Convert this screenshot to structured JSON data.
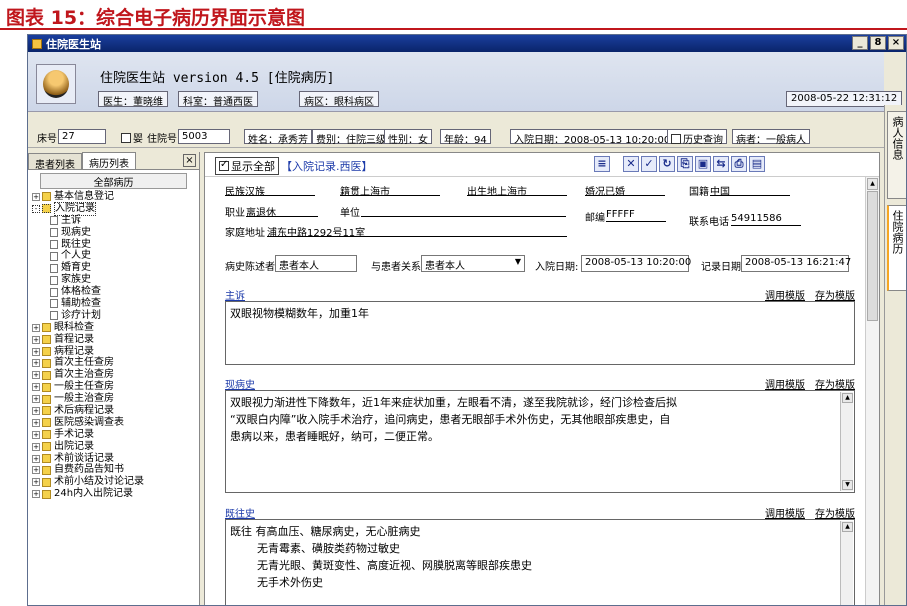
{
  "figure_title": "图表 15：综合电子病历界面示意图",
  "window": {
    "title": "住院医生站",
    "buttons": [
      "_",
      "8",
      "×"
    ]
  },
  "header": {
    "app_title": "住院医生站 version 4.5 [住院病历]",
    "doctor": "医生：董晓维",
    "department": "科室：普通西医",
    "ward": "病区：眼科病区",
    "datetime": "2008-05-22 12:31:12"
  },
  "infobar": {
    "bed_label": "床号",
    "bed_value": "27",
    "baby_label": "婴",
    "inpatient_label": "住院号",
    "inpatient_value": "5003",
    "name": "姓名：承秀芳",
    "fee_type": "费别：住院三级",
    "sex": "性别：女",
    "age": "年龄：94",
    "admit_date": "入院日期：2008-05-13 10:20:00",
    "history_button": "历史查询",
    "patient_type": "病者：一般病人"
  },
  "right_tabs": [
    "病人信息",
    "住院病历"
  ],
  "left_panel": {
    "tabs": [
      "患者列表",
      "病历列表"
    ],
    "close": "×",
    "tree_header": "全部病历",
    "tree": [
      {
        "label": "基本信息登记",
        "type": "folder",
        "level": 0,
        "pm": "+"
      },
      {
        "label": "入院记录",
        "type": "folder",
        "level": 0,
        "pm": "-",
        "selected": true
      },
      {
        "label": "主诉",
        "type": "doc",
        "level": 1
      },
      {
        "label": "现病史",
        "type": "doc",
        "level": 1
      },
      {
        "label": "既往史",
        "type": "doc",
        "level": 1
      },
      {
        "label": "个人史",
        "type": "doc",
        "level": 1
      },
      {
        "label": "婚育史",
        "type": "doc",
        "level": 1
      },
      {
        "label": "家族史",
        "type": "doc",
        "level": 1
      },
      {
        "label": "体格检查",
        "type": "doc",
        "level": 1
      },
      {
        "label": "辅助检查",
        "type": "doc",
        "level": 1
      },
      {
        "label": "诊疗计划",
        "type": "doc",
        "level": 1
      },
      {
        "label": "眼科检查",
        "type": "folder",
        "level": 0,
        "pm": "+"
      },
      {
        "label": "首程记录",
        "type": "folder",
        "level": 0,
        "pm": "+"
      },
      {
        "label": "病程记录",
        "type": "folder",
        "level": 0,
        "pm": "+"
      },
      {
        "label": "首次主任查房",
        "type": "folder",
        "level": 0,
        "pm": "+"
      },
      {
        "label": "首次主治查房",
        "type": "folder",
        "level": 0,
        "pm": "+"
      },
      {
        "label": "一般主任查房",
        "type": "folder",
        "level": 0,
        "pm": "+"
      },
      {
        "label": "一般主治查房",
        "type": "folder",
        "level": 0,
        "pm": "+"
      },
      {
        "label": "术后病程记录",
        "type": "folder",
        "level": 0,
        "pm": "+"
      },
      {
        "label": "医院感染调查表",
        "type": "folder",
        "level": 0,
        "pm": "+"
      },
      {
        "label": "手术记录",
        "type": "folder",
        "level": 0,
        "pm": "+"
      },
      {
        "label": "出院记录",
        "type": "folder",
        "level": 0,
        "pm": "+"
      },
      {
        "label": "术前谈话记录",
        "type": "folder",
        "level": 0,
        "pm": "+"
      },
      {
        "label": "自费药品告知书",
        "type": "folder",
        "level": 0,
        "pm": "+"
      },
      {
        "label": "术前小结及讨论记录",
        "type": "folder",
        "level": 0,
        "pm": "+"
      },
      {
        "label": "24h内入出院记录",
        "type": "folder",
        "level": 0,
        "pm": "+"
      }
    ]
  },
  "main": {
    "show_all": "显示全部",
    "record_title": "【入院记录.西医】",
    "toolbar_icons": [
      "list-icon",
      "delete-icon",
      "check-icon",
      "refresh-icon",
      "copy-icon",
      "save-icon",
      "print-preview-icon",
      "print-icon",
      "clipboard-icon"
    ],
    "toolbar_glyphs": [
      "≡",
      "✕",
      "✓",
      "↻",
      "⎘",
      "▣",
      "⇆",
      "⎙",
      "▤"
    ],
    "fields": {
      "ethnicity": "民族汉族",
      "native_place": "籍贯上海市",
      "birthplace": "出生地上海市",
      "marital": "婚况已婚",
      "nationality_label": "国籍",
      "nationality_value": "中国",
      "occupation_label": "职业",
      "occupation_value": "离退休",
      "work_unit": "单位",
      "postcode_label": "邮编",
      "postcode_value": "FFFFF",
      "address_label": "家庭地址",
      "address_value": "浦东中路1292号11室",
      "phone_label": "联系电话",
      "phone_value": "54911586",
      "narrator_label": "病史陈述者",
      "narrator_value": "患者本人",
      "relation_label": "与患者关系",
      "relation_value": "患者本人",
      "admit_label": "入院日期:",
      "admit_value": "2008-05-13 10:20:00",
      "record_label": "记录日期",
      "record_value": "2008-05-13 16:21:47"
    },
    "template_links": [
      "调用模版",
      "存为模版"
    ],
    "sections": [
      {
        "title": "主诉",
        "lines": [
          "双眼视物模糊数年，加重1年"
        ]
      },
      {
        "title": "现病史",
        "lines": [
          "双眼视力渐进性下降数年，近1年来症状加重，左眼看不清，遂至我院就诊，经门诊检查后拟",
          "“双眼白内障”收入院手术治疗，追问病史，患者无眼部手术外伤史，无其他眼部疾患史，自",
          "患病以来，患者睡眠好，纳可，二便正常。"
        ]
      },
      {
        "title": "既往史",
        "lines": [
          "既往 有高血压、糖尿病史，无心脏病史",
          "无青霉素、磺胺类药物过敏史",
          "无青光眼、黄斑变性、高度近视、网膜脱离等眼部疾患史",
          "无手术外伤史"
        ]
      }
    ]
  }
}
